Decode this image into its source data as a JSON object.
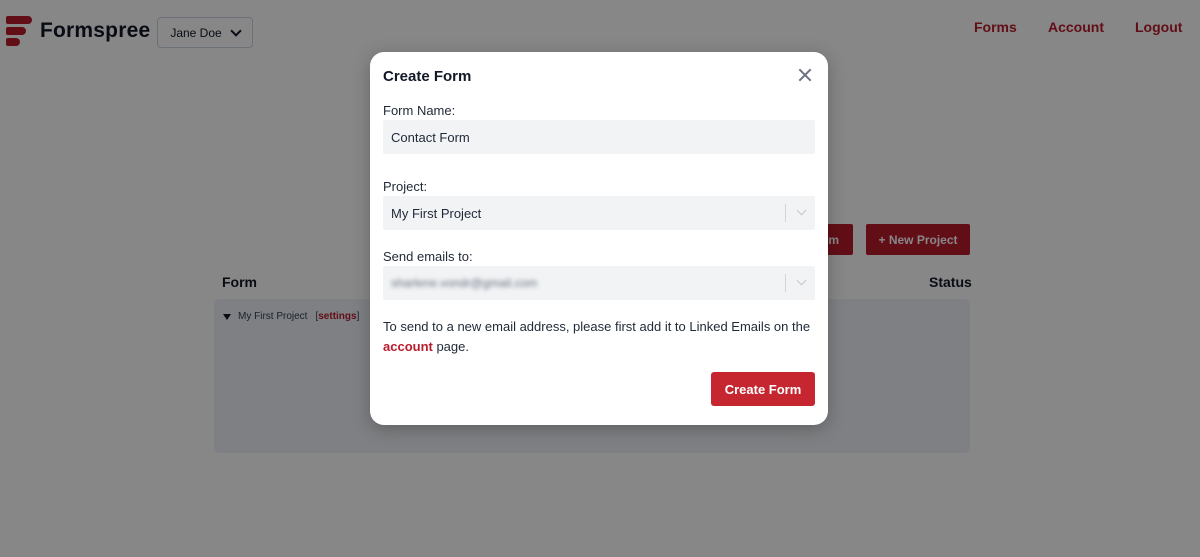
{
  "brand": {
    "name": "Formspree"
  },
  "header": {
    "user_menu_label": "Jane Doe",
    "nav": {
      "forms": "Forms",
      "account": "Account",
      "logout": "Logout"
    }
  },
  "dashboard": {
    "new_form_partial_label": "m",
    "new_project_label": "+ New Project",
    "columns": {
      "form": "Form",
      "status": "Status"
    },
    "project": {
      "name": "My First Project",
      "settings_open": "[",
      "settings_label": "settings",
      "settings_close": "]"
    }
  },
  "modal": {
    "title": "Create Form",
    "form_name": {
      "label": "Form Name:",
      "value": "Contact Form"
    },
    "project": {
      "label": "Project:",
      "value": "My First Project"
    },
    "send_emails": {
      "label": "Send emails to:",
      "value": "sharlene.vondr@gmail.com"
    },
    "help": {
      "before": "To send to a new email address, please first add it to Linked Emails on the ",
      "link": "account",
      "after": " page."
    },
    "submit_label": "Create Form"
  },
  "colors": {
    "accent": "#b91c2c",
    "overlay": "rgba(0,0,0,0.47)"
  },
  "icons": {
    "close": "close-icon",
    "dropdown": "chevron-down-icon",
    "collapse": "triangle-down-icon"
  }
}
